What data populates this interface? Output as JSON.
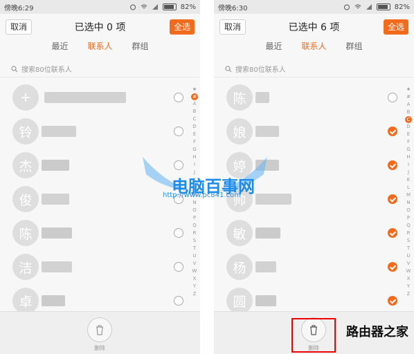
{
  "screens": [
    {
      "status": {
        "time": "傍晚6:29",
        "battery": "82%"
      },
      "header": {
        "cancel": "取消",
        "title": "已选中 0 项",
        "select_all": "全选"
      },
      "tabs": [
        {
          "label": "最近"
        },
        {
          "label": "联系人",
          "active": true
        },
        {
          "label": "群组"
        }
      ],
      "search_placeholder": "搜索80位联系人",
      "contacts": [
        {
          "avatar": "+",
          "checked": false
        },
        {
          "avatar": "铃",
          "checked": false
        },
        {
          "avatar": "杰",
          "checked": false
        },
        {
          "avatar": "俊",
          "checked": false
        },
        {
          "avatar": "陈",
          "checked": false
        },
        {
          "avatar": "洁",
          "checked": false
        },
        {
          "avatar": "卓",
          "checked": false
        }
      ],
      "index_letters": [
        "★",
        "#",
        "A",
        "B",
        "C",
        "D",
        "E",
        "F",
        "G",
        "H",
        "I",
        "J",
        "K",
        "L",
        "M",
        "N",
        "O",
        "P",
        "Q",
        "R",
        "S",
        "T",
        "U",
        "V",
        "W",
        "X",
        "Y",
        "Z"
      ],
      "index_highlight": "#",
      "delete_label": "删除"
    },
    {
      "status": {
        "time": "傍晚6:30",
        "battery": "82%"
      },
      "header": {
        "cancel": "取消",
        "title": "已选中 6 项",
        "select_all": "全选"
      },
      "tabs": [
        {
          "label": "最近"
        },
        {
          "label": "联系人",
          "active": true
        },
        {
          "label": "群组"
        }
      ],
      "search_placeholder": "搜索80位联系人",
      "contacts": [
        {
          "avatar": "陈",
          "checked": false
        },
        {
          "avatar": "娘",
          "checked": true
        },
        {
          "avatar": "婷",
          "checked": true
        },
        {
          "avatar": "帅",
          "checked": true
        },
        {
          "avatar": "敏",
          "checked": true
        },
        {
          "avatar": "杨",
          "checked": true
        },
        {
          "avatar": "圆",
          "checked": true
        }
      ],
      "index_letters": [
        "★",
        "#",
        "A",
        "B",
        "C",
        "D",
        "E",
        "F",
        "G",
        "H",
        "I",
        "J",
        "K",
        "L",
        "M",
        "N",
        "O",
        "P",
        "Q",
        "R",
        "S",
        "T",
        "U",
        "V",
        "W",
        "X",
        "Y",
        "Z"
      ],
      "index_highlight": "C",
      "delete_label": "删除"
    }
  ],
  "watermark": {
    "site": "电脑百事网",
    "url": "http://www.pc841.com",
    "logo": "路由器之家"
  },
  "colors": {
    "accent": "#f26b1d",
    "highlight_box": "#e00000"
  }
}
